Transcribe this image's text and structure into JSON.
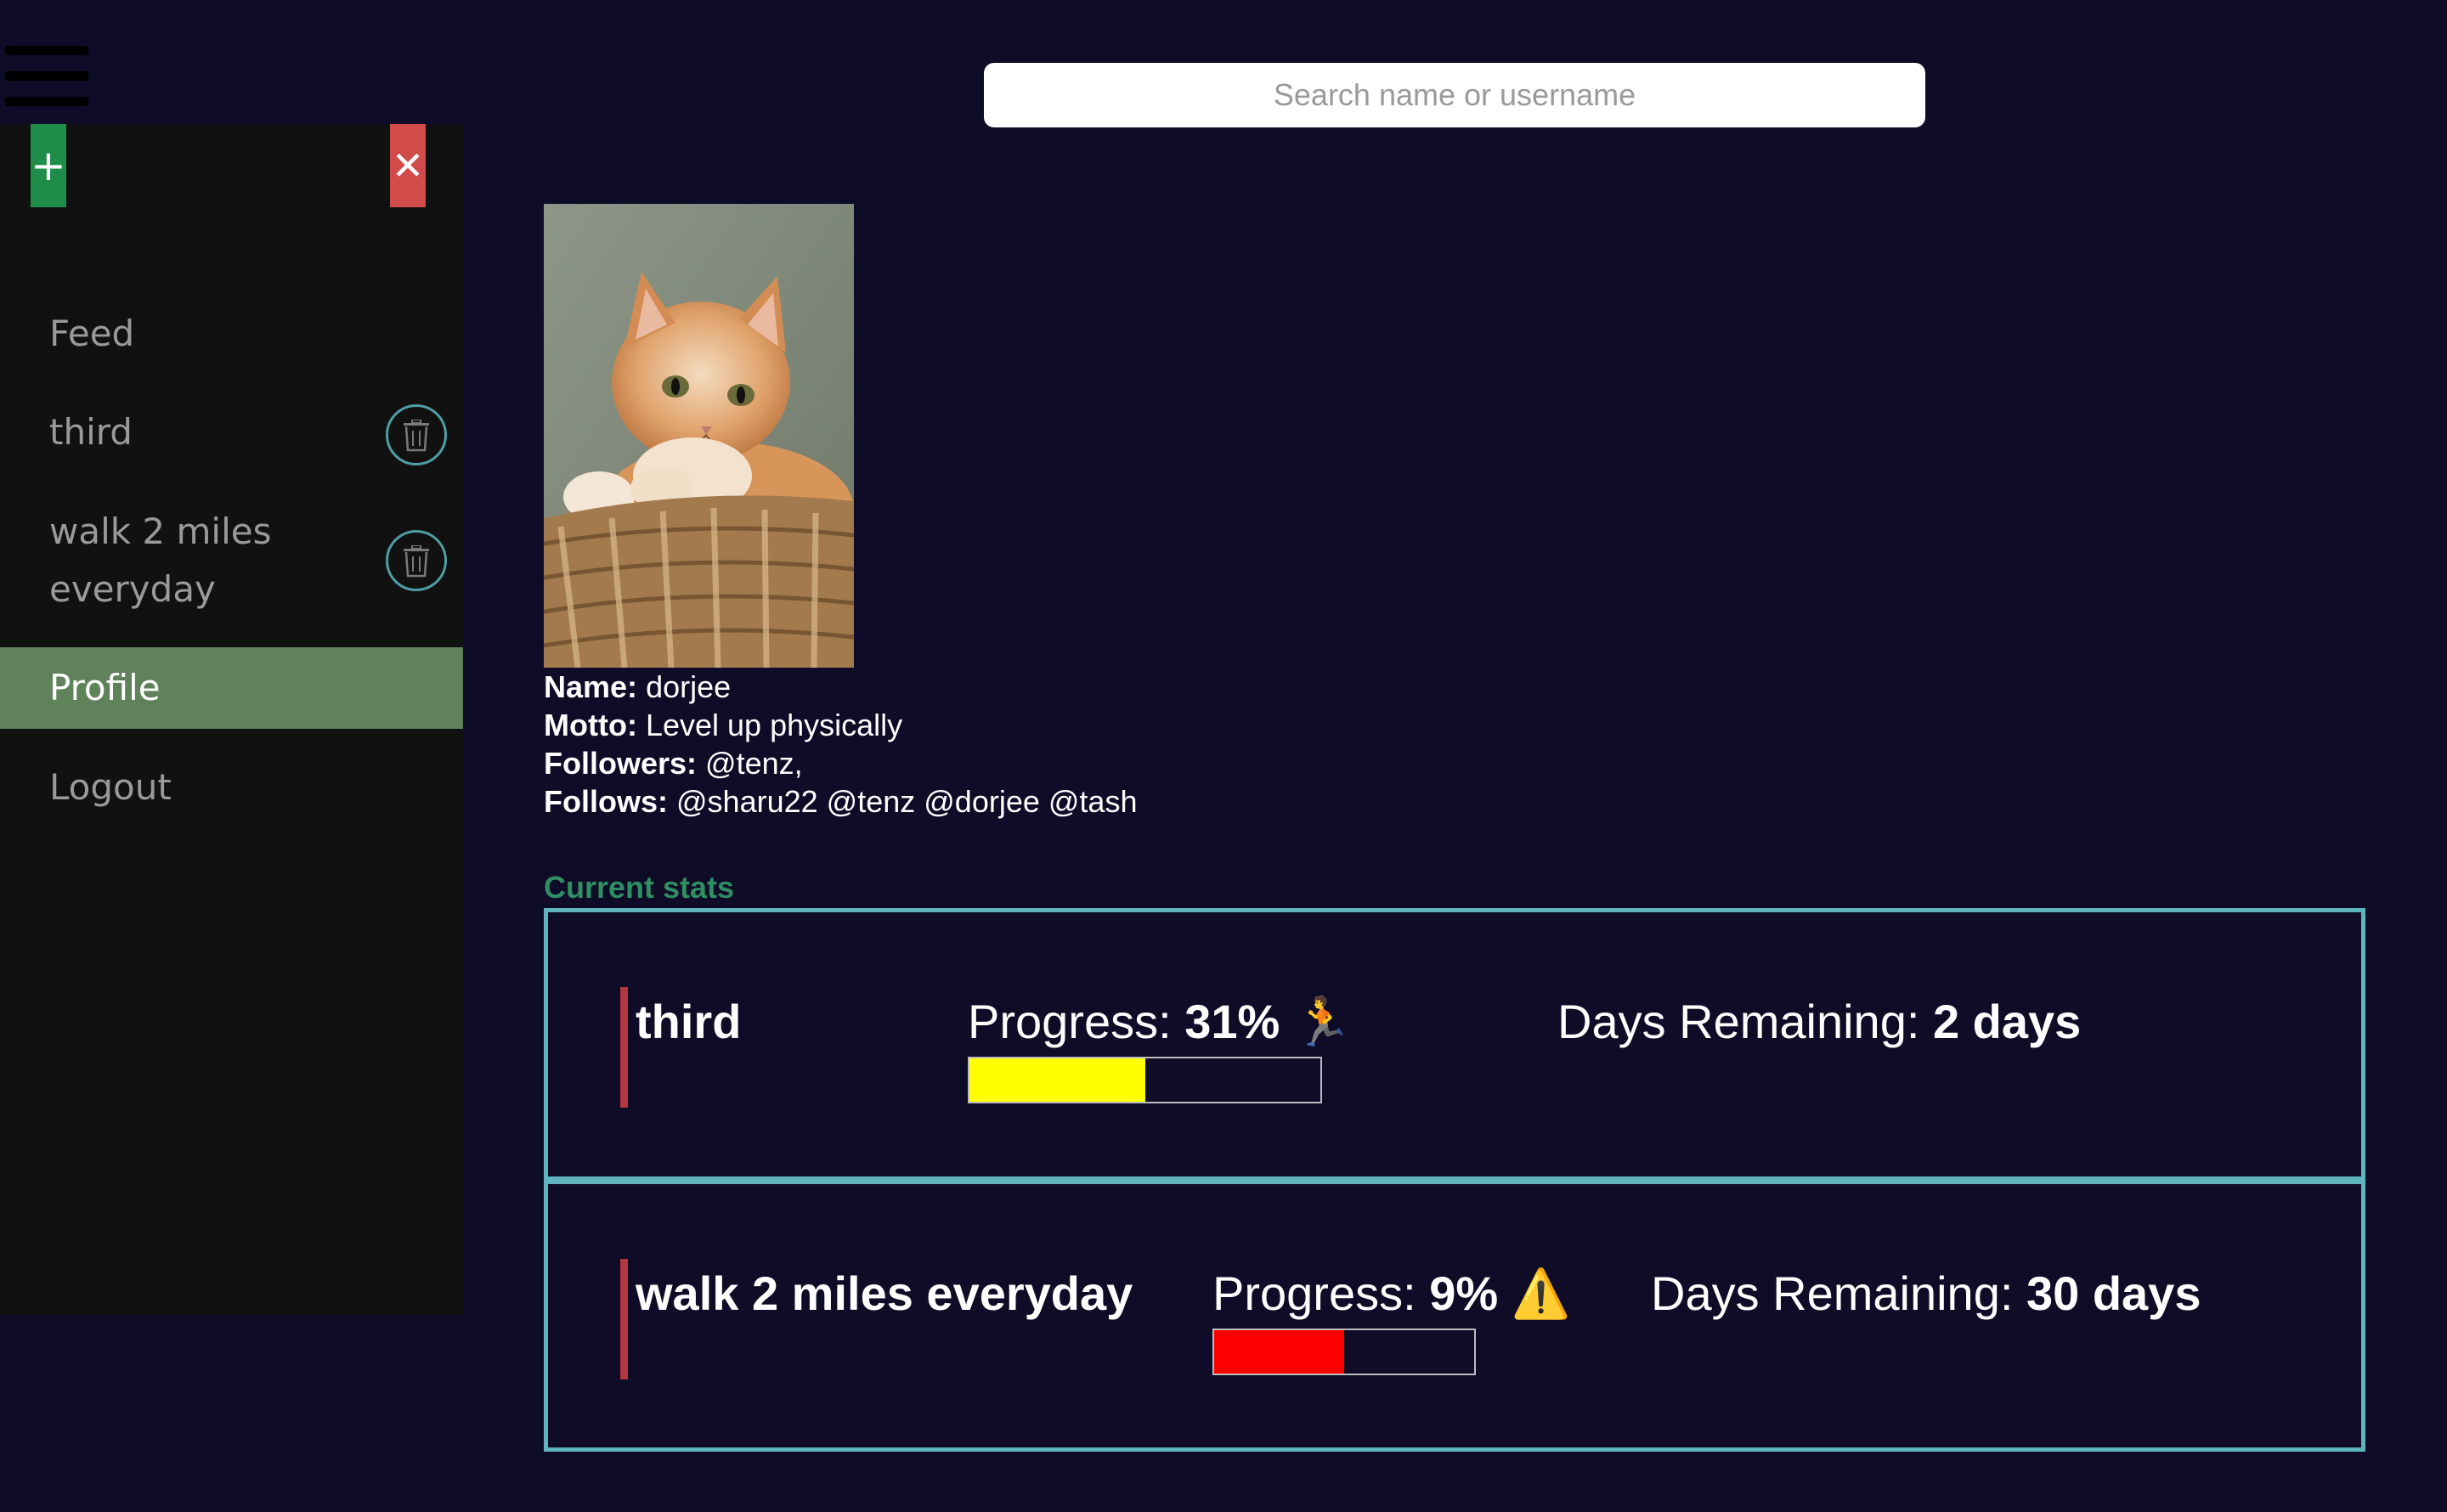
{
  "search": {
    "placeholder": "Search name or username"
  },
  "sidebar": {
    "add_label": "+",
    "close_label": "✕",
    "items": [
      {
        "label": "Feed"
      },
      {
        "label": "third"
      },
      {
        "label": "walk 2 miles everyday"
      },
      {
        "label": "Profile"
      },
      {
        "label": "Logout"
      }
    ]
  },
  "profile": {
    "name_label": "Name:",
    "name": "dorjee",
    "motto_label": "Motto:",
    "motto": "Level up physically",
    "followers_label": "Followers:",
    "followers": "@tenz,",
    "follows_label": "Follows:",
    "follows": "@sharu22 @tenz @dorjee @tash"
  },
  "stats": {
    "title": "Current stats",
    "goals": [
      {
        "name": "third",
        "progress_label": "Progress:",
        "progress_text": "31%",
        "progress_value": 0.5,
        "status_icon": "🏃",
        "bar_color": "#ffff00",
        "days_label": "Days Remaining:",
        "days_text": "2 days"
      },
      {
        "name": "walk 2 miles everyday",
        "progress_label": "Progress:",
        "progress_text": "9%",
        "progress_value": 0.5,
        "status_icon": "⚠️",
        "bar_color": "#ff0000",
        "days_label": "Days Remaining:",
        "days_text": "30 days"
      }
    ]
  },
  "colors": {
    "background": "#0e0c27",
    "sidebar": "#111111",
    "active_item": "#5f825a",
    "accent_green": "#1e8d4a",
    "accent_red": "#d24b4b",
    "box_border": "#5fb4bf",
    "stats_title": "#2f8f63"
  }
}
